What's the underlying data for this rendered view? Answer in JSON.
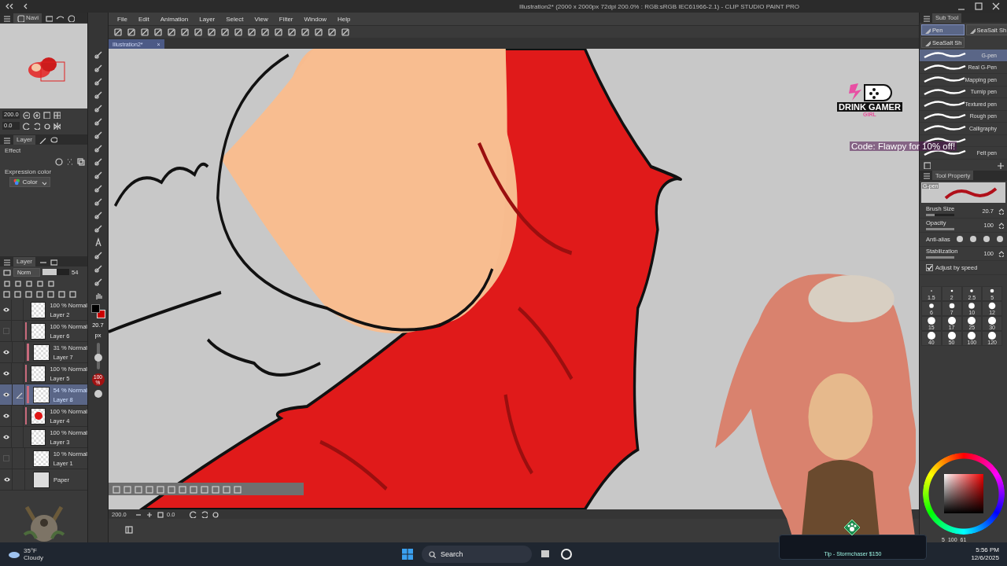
{
  "window": {
    "title": "Illustration2* (2000 x 2000px 72dpi 200.0% : RGB:sRGB IEC61966-2.1)  - CLIP STUDIO PAINT PRO"
  },
  "menu": [
    "File",
    "Edit",
    "Animation",
    "Layer",
    "Select",
    "View",
    "Filter",
    "Window",
    "Help"
  ],
  "document_tab": {
    "label": "Illustration2*",
    "close": "×"
  },
  "navigator": {
    "tab": "Navi",
    "zoom": "200.0",
    "rotation": "0.0"
  },
  "layer_property": {
    "tab": "Layer",
    "effect_label": "Effect",
    "expression_label": "Expression color",
    "expression_value": "Color"
  },
  "layer_panel": {
    "tab": "Layer",
    "blend_mode": "Norm",
    "opacity": "54",
    "layers": [
      {
        "mode": "100 % Normal",
        "name": "Layer 2",
        "visible": true,
        "clipped": false,
        "selected": false
      },
      {
        "mode": "100 % Normal",
        "name": "Layer 6",
        "visible": false,
        "clipped": true,
        "selected": false
      },
      {
        "mode": "31 % Normal",
        "name": "Layer 7",
        "visible": true,
        "clipped": true,
        "selected": false
      },
      {
        "mode": "100 % Normal",
        "name": "Layer 5",
        "visible": true,
        "clipped": true,
        "selected": false
      },
      {
        "mode": "54 % Normal",
        "name": "Layer 8",
        "visible": true,
        "clipped": true,
        "selected": true
      },
      {
        "mode": "100 % Normal",
        "name": "Layer 4",
        "visible": true,
        "clipped": true,
        "selected": false
      },
      {
        "mode": "100 % Normal",
        "name": "Layer 3",
        "visible": true,
        "clipped": false,
        "selected": false
      },
      {
        "mode": "10 % Normal",
        "name": "Layer 1",
        "visible": false,
        "clipped": false,
        "selected": false
      },
      {
        "name": "Paper",
        "visible": true,
        "clipped": false,
        "selected": false
      }
    ]
  },
  "tool_column": {
    "brush_size": "20.7",
    "brush_unit": "px",
    "size_slider": {
      "level": 0.4
    },
    "opacity_badge": "100",
    "opacity_unit": "%"
  },
  "canvas_status": {
    "zoom": "200.0",
    "rotation": "0.0"
  },
  "sub_tool": {
    "tab": "Sub Tool",
    "groups": [
      {
        "label": "Pen",
        "selected": true
      },
      {
        "label": "SeaSalt Sh",
        "selected": false
      },
      {
        "label": "SeaSalt Sh",
        "selected": false
      }
    ],
    "brushes": [
      {
        "name": "G-pen",
        "selected": true
      },
      {
        "name": "Real G-Pen",
        "selected": false
      },
      {
        "name": "Mapping pen",
        "selected": false
      },
      {
        "name": "Turnip pen",
        "selected": false
      },
      {
        "name": "Textured pen",
        "selected": false
      },
      {
        "name": "Rough pen",
        "selected": false
      },
      {
        "name": "Calligraphy",
        "selected": false
      },
      {
        "selected": false
      },
      {
        "name": "Felt pen",
        "selected": false
      }
    ]
  },
  "tool_property": {
    "tab": "Tool Property",
    "preview_label": "G-pen",
    "rows": [
      {
        "kind": "value",
        "label": "Brush Size",
        "value": "20.7",
        "level": 0.3
      },
      {
        "kind": "value",
        "label": "Opacity",
        "value": "100",
        "level": 1
      },
      {
        "kind": "choice",
        "label": "Anti-alias"
      },
      {
        "kind": "value",
        "label": "Stabilization",
        "value": "100",
        "level": 1
      },
      {
        "kind": "check",
        "label": "Adjust by speed",
        "checked": true
      }
    ]
  },
  "brush_sizes": [
    "1.5",
    "2",
    "2.5",
    "5",
    "6",
    "7",
    "10",
    "12",
    "15",
    "17",
    "25",
    "30",
    "40",
    "50",
    "100",
    "120"
  ],
  "color_panel": {
    "values": [
      "5",
      "100",
      "61"
    ]
  },
  "overlay": {
    "logo_line1": "DRINK GAMER",
    "logo_line2": "GIRL",
    "promo": "Code: Flawpy for 10% off!",
    "tip": "Tip - Stormchaser $150"
  },
  "taskbar": {
    "temperature": "35°F",
    "weather": "Cloudy",
    "search": "Search",
    "time": "5:56 PM",
    "date": "12/6/2025"
  }
}
